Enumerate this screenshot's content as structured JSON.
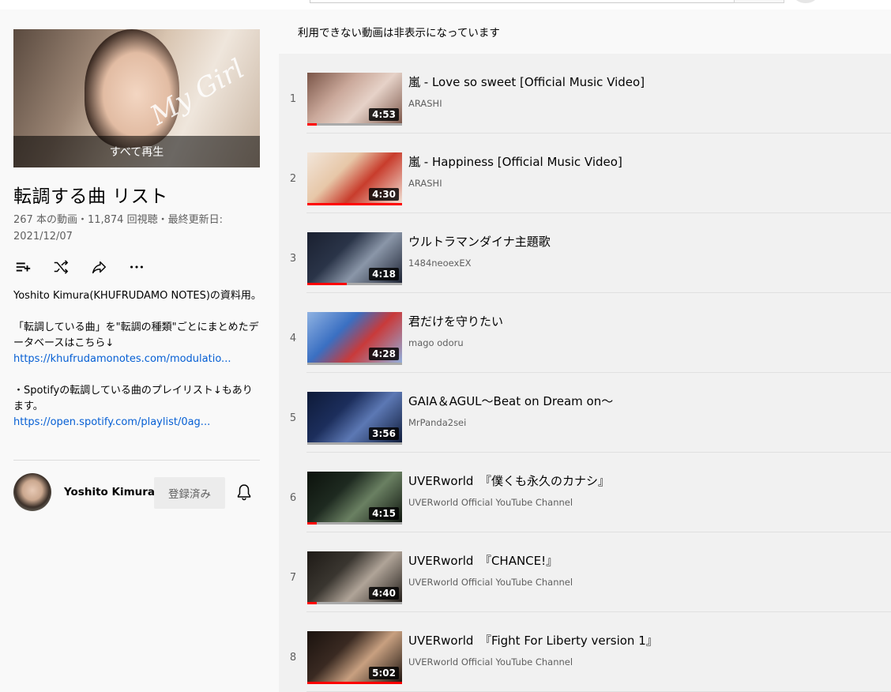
{
  "playlist": {
    "play_all_label": "すべて再生",
    "title": "転調する曲 リスト",
    "stats": "267 本の動画・11,874 回視聴・最終更新日: 2021/12/07",
    "description": {
      "line1": "Yoshito Kimura(KHUFRUDAMO NOTES)の資料用。",
      "line2": "「転調している曲」を\"転調の種類\"ごとにまとめたデータベースはこちら↓",
      "link1": "https://khufrudamonotes.com/modulatio...",
      "line3": "・Spotifyの転調している曲のプレイリスト↓もあります。",
      "link2": "https://open.spotify.com/playlist/0ag..."
    },
    "owner": {
      "name": "Yoshito Kimura",
      "subscribe_label": "登録済み"
    }
  },
  "notice": "利用できない動画は非表示になっています",
  "icons": {
    "add_to_queue": "add-to-queue-icon",
    "shuffle": "shuffle-icon",
    "share": "share-icon",
    "more": "more-icon",
    "bell": "bell-icon"
  },
  "videos": [
    {
      "index": "1",
      "title": "嵐 - Love so sweet [Official Music Video]",
      "channel": "ARASHI",
      "duration": "4:53",
      "watched": 0.1,
      "thumb": [
        "#caa89a",
        "#e6d2c8",
        "#7a5548"
      ]
    },
    {
      "index": "2",
      "title": "嵐 - Happiness [Official Music Video]",
      "channel": "ARASHI",
      "duration": "4:30",
      "watched": 1.0,
      "thumb": [
        "#e7c7a8",
        "#c83c2c",
        "#f2e6da"
      ]
    },
    {
      "index": "3",
      "title": "ウルトラマンダイナ主題歌",
      "channel": "1484neoexEX",
      "duration": "4:18",
      "watched": 0.42,
      "thumb": [
        "#2a3448",
        "#8a96a8",
        "#1a2030"
      ]
    },
    {
      "index": "4",
      "title": "君だけを守りたい",
      "channel": "mago odoru",
      "duration": "4:28",
      "watched": 0.0,
      "thumb": [
        "#3a6fc2",
        "#c93a3a",
        "#8fb2e2"
      ]
    },
    {
      "index": "5",
      "title": "GAIA＆AGUL～Beat on Dream on～",
      "channel": "MrPanda2sei",
      "duration": "3:56",
      "watched": 0.0,
      "thumb": [
        "#1c2e5c",
        "#5c78b4",
        "#0e1a38"
      ]
    },
    {
      "index": "6",
      "title": "UVERworld　『僕くも永久のカナシ』",
      "channel": "UVERworld Official YouTube Channel",
      "duration": "4:15",
      "watched": 0.1,
      "thumb": [
        "#1e2a20",
        "#6a8062",
        "#0c120c"
      ]
    },
    {
      "index": "7",
      "title": "UVERworld　『CHANCE!』",
      "channel": "UVERworld Official YouTube Channel",
      "duration": "4:40",
      "watched": 0.1,
      "thumb": [
        "#3a3630",
        "#b0a498",
        "#1e1a16"
      ]
    },
    {
      "index": "8",
      "title": "UVERworld　『Fight For Liberty version 1』",
      "channel": "UVERworld Official YouTube Channel",
      "duration": "5:02",
      "watched": 1.0,
      "thumb": [
        "#3a2a22",
        "#c8a080",
        "#1a120e"
      ]
    }
  ]
}
